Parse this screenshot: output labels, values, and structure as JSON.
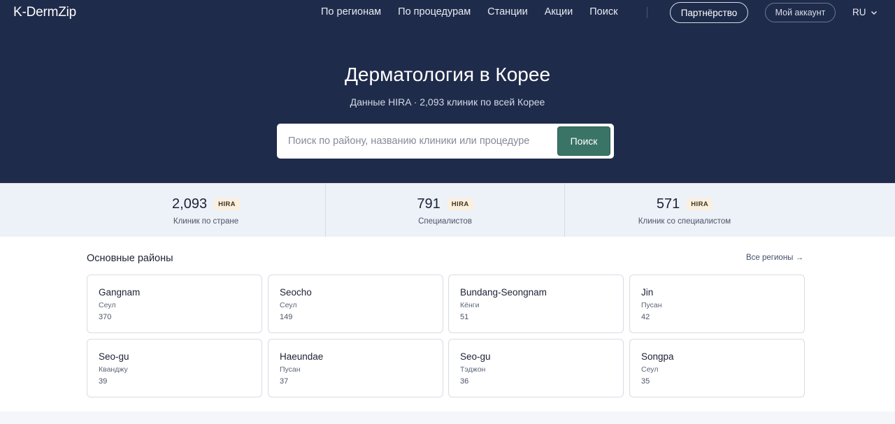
{
  "header": {
    "logo": "K-DermZip",
    "nav": [
      "По регионам",
      "По процедурам",
      "Станции",
      "Акции",
      "Поиск"
    ],
    "partner_label": "Партнёрство",
    "account_label": "Мой аккаунт",
    "language": "RU"
  },
  "hero": {
    "title": "Дерматология в Корее",
    "subtitle": "Данные HIRA · 2,093 клиник по всей Корее",
    "search_placeholder": "Поиск по району, названию клиники или процедуре",
    "search_button": "Поиск"
  },
  "stats": [
    {
      "value": "2,093",
      "badge": "HIRA",
      "label": "Клиник по стране"
    },
    {
      "value": "791",
      "badge": "HIRA",
      "label": "Специалистов"
    },
    {
      "value": "571",
      "badge": "HIRA",
      "label": "Клиник со специалистом"
    }
  ],
  "districts": {
    "title": "Основные районы",
    "all_link": "Все регионы →",
    "items": [
      {
        "name": "Gangnam",
        "city": "Сеул",
        "count": "370"
      },
      {
        "name": "Seocho",
        "city": "Сеул",
        "count": "149"
      },
      {
        "name": "Bundang-Seongnam",
        "city": "Кёнги",
        "count": "51"
      },
      {
        "name": "Jin",
        "city": "Пусан",
        "count": "42"
      },
      {
        "name": "Seo-gu",
        "city": "Кванджу",
        "count": "39"
      },
      {
        "name": "Haeundae",
        "city": "Пусан",
        "count": "37"
      },
      {
        "name": "Seo-gu",
        "city": "Тэджон",
        "count": "36"
      },
      {
        "name": "Songpa",
        "city": "Сеул",
        "count": "35"
      }
    ]
  },
  "colors": {
    "header_bg": "#1f2b4a",
    "accent_green": "#3a7466",
    "stats_bg": "#edf1f8",
    "badge_bg": "#fbf0de"
  }
}
